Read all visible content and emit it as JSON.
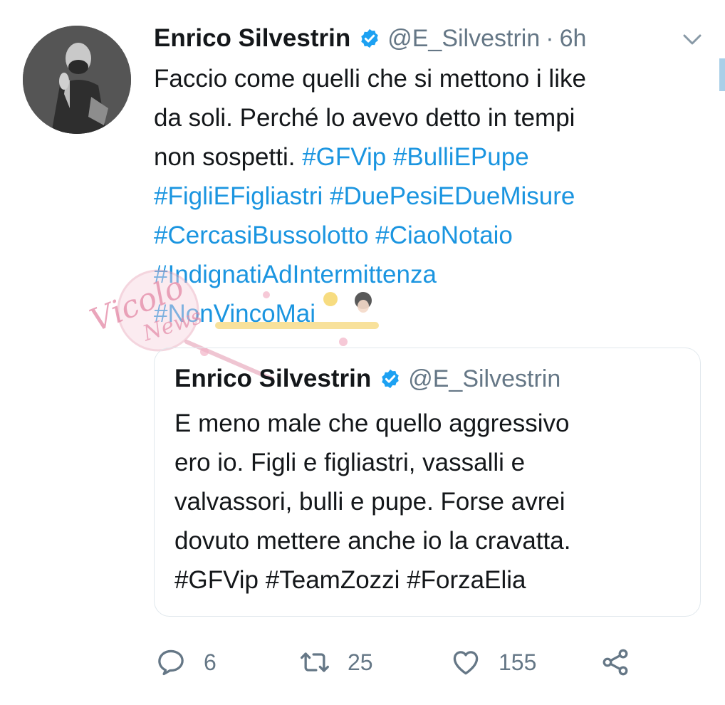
{
  "tweet": {
    "author_name": "Enrico Silvestrin",
    "handle": "@E_Silvestrin",
    "separator": "·",
    "time": "6h",
    "text_lines": [
      "Faccio come quelli che si mettono i like",
      "da soli. Perché lo avevo detto in tempi",
      "non sospetti."
    ],
    "hashtags": {
      "h1": "#GFVip",
      "h2": "#BulliEPupe",
      "h3": "#FigliEFigliastri",
      "h4": "#DuePesiEDueMisure",
      "h5": "#CercasiBussolotto",
      "h6": "#CiaoNotaio",
      "h7": "#IndignatiAdIntermittenza",
      "h8": "#NonVincoMai"
    }
  },
  "quoted_tweet": {
    "author_name": "Enrico Silvestrin",
    "handle": "@E_Silvestrin",
    "text_lines": [
      "E meno male che quello aggressivo",
      "ero io. Figli e figliastri, vassalli e",
      "valvassori, bulli e pupe. Forse avrei",
      "dovuto mettere anche io la cravatta."
    ],
    "hashtags": [
      "#GFVip",
      "#TeamZozzi",
      "#ForzaElia"
    ]
  },
  "actions": {
    "replies": "6",
    "retweets": "25",
    "likes": "155"
  },
  "watermark": {
    "text": "Vicolo delle News"
  },
  "colors": {
    "hashtag": "#1b95e0",
    "secondary_text": "#657786",
    "verified": "#1da1f2",
    "border": "#e1e8ed"
  },
  "icons": [
    "verified-badge-icon",
    "chevron-down-icon",
    "reply-icon",
    "retweet-icon",
    "like-icon",
    "share-icon"
  ]
}
